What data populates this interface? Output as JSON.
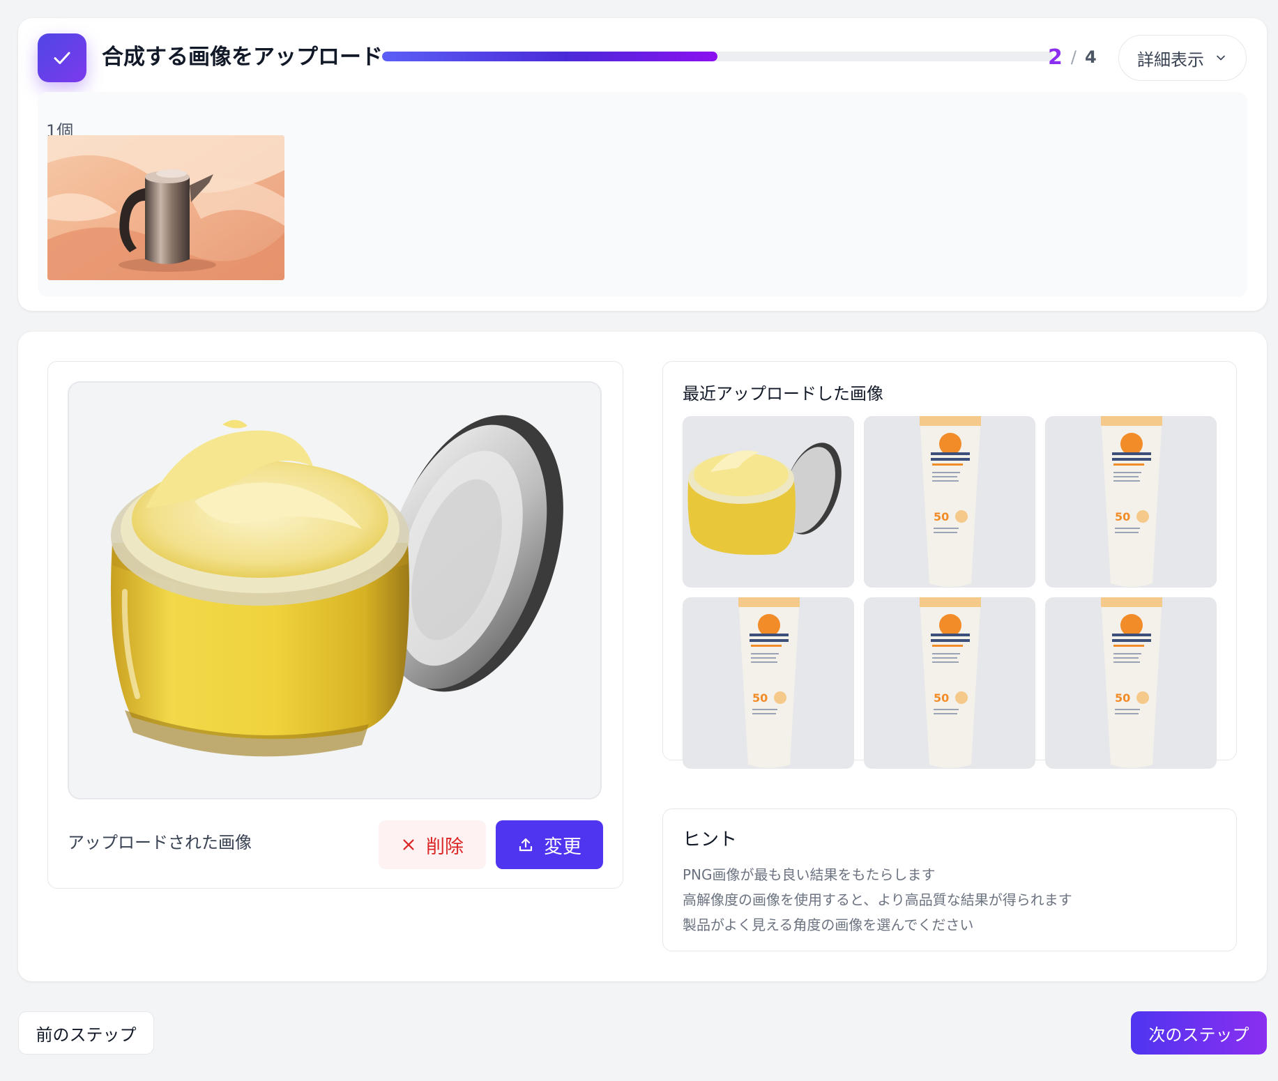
{
  "step": {
    "title": "合成する画像をアップロード",
    "current": "2",
    "separator": "/",
    "total": "4",
    "progress_percent": 50,
    "detail_label": "詳細表示",
    "uploaded_count": "1個",
    "icon": "check-icon"
  },
  "preview": {
    "label": "アップロードされた画像",
    "delete_label": "削除",
    "change_label": "変更"
  },
  "recent": {
    "title": "最近アップロードした画像",
    "items": [
      "cream-jar",
      "sunscreen-tube",
      "sunscreen-tube",
      "sunscreen-tube",
      "sunscreen-tube",
      "sunscreen-tube"
    ]
  },
  "hint": {
    "title": "ヒント",
    "items": [
      "PNG画像が最も良い結果をもたらします",
      "高解像度の画像を使用すると、より高品質な結果が得られます",
      "製品がよく見える角度の画像を選んでください"
    ]
  },
  "footer": {
    "prev_label": "前のステップ",
    "next_label": "次のステップ"
  },
  "colors": {
    "accent": "#4f35f0",
    "accent_purple": "#8b2ef0",
    "danger": "#dc2626",
    "danger_bg": "#fef2f2"
  }
}
